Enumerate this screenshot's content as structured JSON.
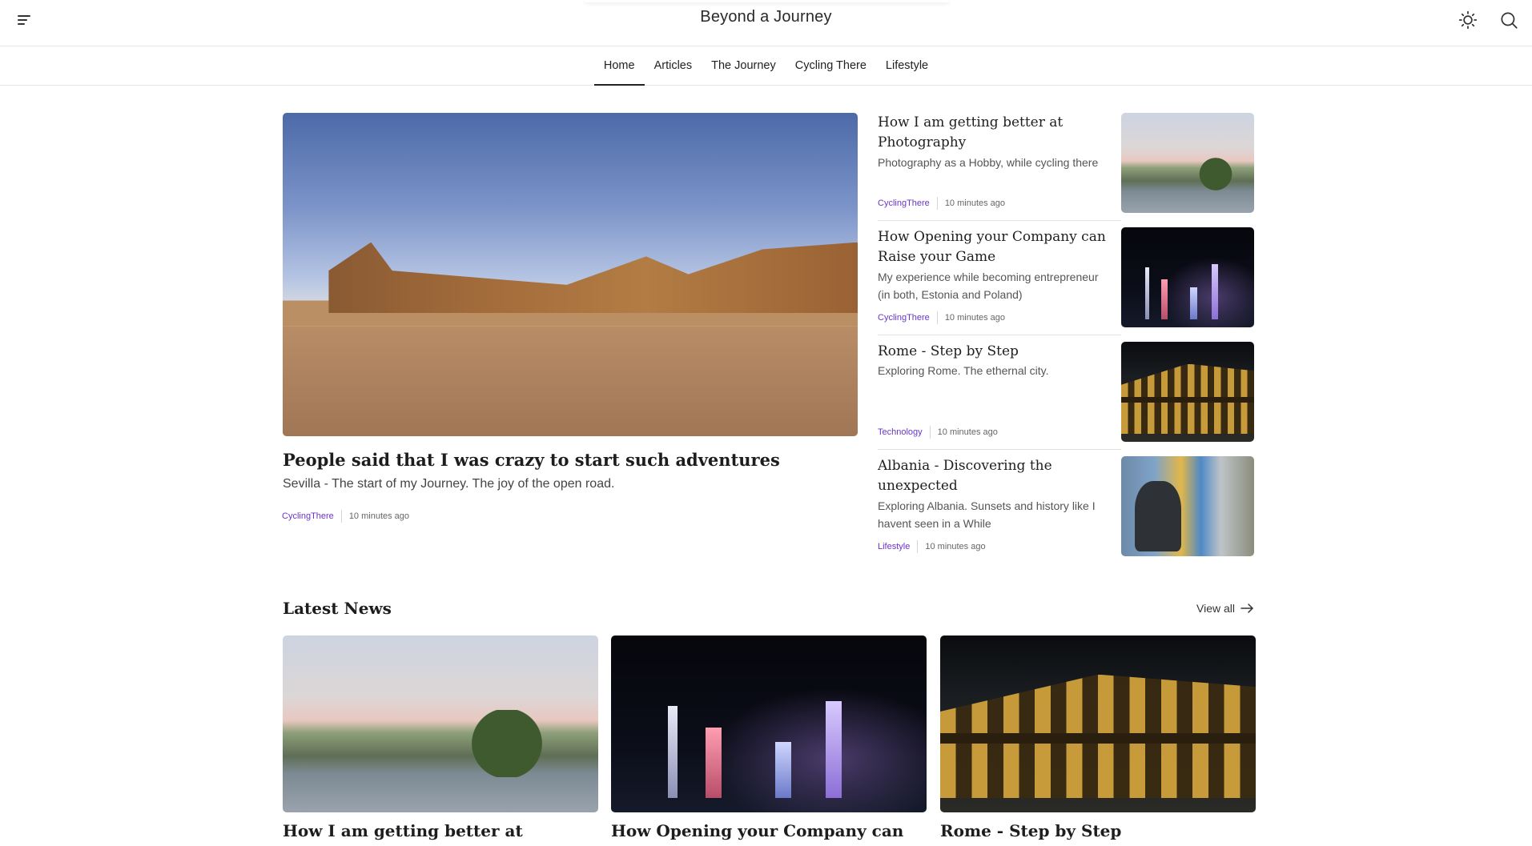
{
  "header": {
    "site_title": "Beyond a Journey",
    "menu_icon": "menu-icon",
    "theme_icon": "sun-icon",
    "search_icon": "search-icon"
  },
  "nav": {
    "items": [
      {
        "label": "Home",
        "active": true
      },
      {
        "label": "Articles",
        "active": false
      },
      {
        "label": "The Journey",
        "active": false
      },
      {
        "label": "Cycling There",
        "active": false
      },
      {
        "label": "Lifestyle",
        "active": false
      }
    ]
  },
  "hero": {
    "title": "People said that I was crazy to start such adventures",
    "subtitle": "Sevilla - The start of my Journey. The joy of the open road.",
    "category": "CyclingThere",
    "time": "10 minutes ago"
  },
  "side_articles": [
    {
      "title": "How I am getting better at Photography",
      "subtitle": "Photography as a Hobby, while cycling there",
      "category": "CyclingThere",
      "time": "10 minutes ago"
    },
    {
      "title": "How Opening your Company can Raise your Game",
      "subtitle": "My experience while becoming entrepreneur (in both, Estonia and Poland)",
      "category": "CyclingThere",
      "time": "10 minutes ago"
    },
    {
      "title": "Rome - Step by Step",
      "subtitle": "Exploring Rome. The ethernal city.",
      "category": "Technology",
      "time": "10 minutes ago"
    },
    {
      "title": "Albania - Discovering the unexpected",
      "subtitle": "Exploring Albania. Sunsets and history like I havent seen in a While",
      "category": "Lifestyle",
      "time": "10 minutes ago"
    }
  ],
  "latest": {
    "heading": "Latest News",
    "view_all": "View all",
    "cards": [
      {
        "title": "How I am getting better at"
      },
      {
        "title": "How Opening your Company can"
      },
      {
        "title": "Rome - Step by Step"
      }
    ]
  },
  "colors": {
    "category_accent": "#6b35c9",
    "divider": "#e6e6e6"
  }
}
